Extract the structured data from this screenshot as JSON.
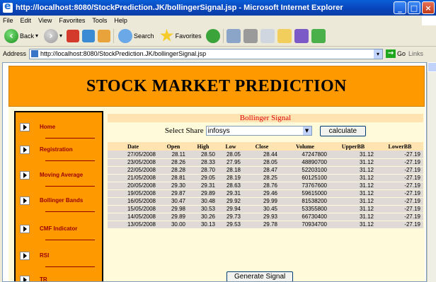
{
  "window": {
    "title": "http://localhost:8080/StockPrediction.JK/bollingerSignal.jsp - Microsoft Internet Explorer",
    "controls": [
      "_",
      "□",
      "×"
    ]
  },
  "menu": [
    "File",
    "Edit",
    "View",
    "Favorites",
    "Tools",
    "Help"
  ],
  "toolbar": {
    "back_label": "Back",
    "search_label": "Search",
    "favorites_label": "Favorites"
  },
  "address": {
    "label": "Address",
    "url": "http://localhost:8080/StockPrediction.JK/bollingerSignal.jsp",
    "go_label": "Go",
    "links_label": "Links"
  },
  "page": {
    "banner": "STOCK MARKET PREDICTION",
    "sidebar": [
      {
        "label": "Home"
      },
      {
        "label": "Registration"
      },
      {
        "label": "Moving Average"
      },
      {
        "label": "Bollinger Bands"
      },
      {
        "label": "CMF Indicator"
      },
      {
        "label": "RSI"
      },
      {
        "label": "TR"
      }
    ],
    "panel_title": "Bollinger Signal",
    "select_label": "Select Share",
    "selected_share": "infosys",
    "calculate_label": "calculate",
    "columns": [
      "Date",
      "Open",
      "High",
      "Low",
      "Close",
      "Volume",
      "UpperBB",
      "LowerBB"
    ],
    "rows": [
      [
        "27/05/2008",
        "28.11",
        "28.50",
        "28.05",
        "28.44",
        "47247800",
        "31.12",
        "-27.19"
      ],
      [
        "23/05/2008",
        "28.26",
        "28.33",
        "27.95",
        "28.05",
        "48890700",
        "31.12",
        "-27.19"
      ],
      [
        "22/05/2008",
        "28.28",
        "28.70",
        "28.18",
        "28.47",
        "52203100",
        "31.12",
        "-27.19"
      ],
      [
        "21/05/2008",
        "28.81",
        "29.05",
        "28.19",
        "28.25",
        "60125100",
        "31.12",
        "-27.19"
      ],
      [
        "20/05/2008",
        "29.30",
        "29.31",
        "28.63",
        "28.76",
        "73767600",
        "31.12",
        "-27.19"
      ],
      [
        "19/05/2008",
        "29.87",
        "29.89",
        "29.31",
        "29.46",
        "59615000",
        "31.12",
        "-27.19"
      ],
      [
        "16/05/2008",
        "30.47",
        "30.48",
        "29.92",
        "29.99",
        "81538200",
        "31.12",
        "-27.19"
      ],
      [
        "15/05/2008",
        "29.98",
        "30.53",
        "29.94",
        "30.45",
        "53355800",
        "31.12",
        "-27.19"
      ],
      [
        "14/05/2008",
        "29.89",
        "30.26",
        "29.73",
        "29.93",
        "66730400",
        "31.12",
        "-27.19"
      ],
      [
        "13/05/2008",
        "30.00",
        "30.13",
        "29.53",
        "29.78",
        "70934700",
        "31.12",
        "-27.19"
      ]
    ],
    "generate_label": "Generate Signal"
  }
}
